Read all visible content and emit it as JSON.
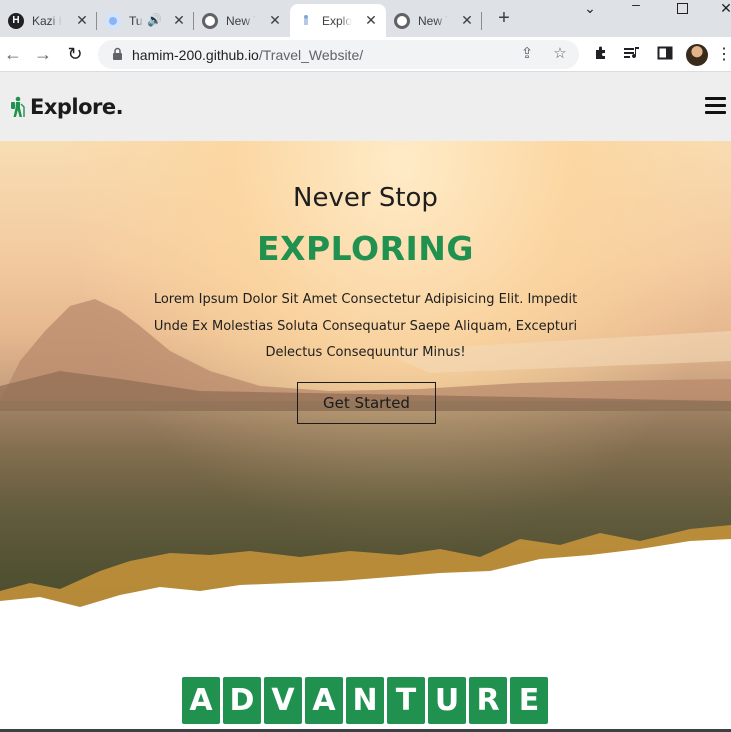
{
  "browser": {
    "tabs": [
      {
        "title": "Kazi H",
        "favicon": "H",
        "favicon_color": "#202124",
        "audio": false,
        "active": false
      },
      {
        "title": "Tu",
        "favicon": "",
        "favicon_color": "#8ab4f8",
        "audio": true,
        "active": false
      },
      {
        "title": "New T",
        "favicon": "chrome",
        "favicon_color": "#5f6368",
        "audio": false,
        "active": false
      },
      {
        "title": "Explor",
        "favicon": "walker",
        "favicon_color": "#219150",
        "audio": false,
        "active": true
      },
      {
        "title": "New T",
        "favicon": "chrome",
        "favicon_color": "#5f6368",
        "audio": false,
        "active": false
      }
    ],
    "url_host": "hamim-200.github.io",
    "url_path": "/Travel_Website/"
  },
  "site": {
    "brand": "Explore.",
    "hero": {
      "subtitle": "Never Stop",
      "title": "EXPLORING",
      "paragraph": "Lorem Ipsum Dolor Sit Amet Consectetur Adipisicing Elit. Impedit Unde Ex Molestias Soluta Consequatur Saepe Aliquam, Excepturi Delectus Consequuntur Minus!",
      "button": "Get Started"
    },
    "section_heading_letters": [
      "A",
      "D",
      "V",
      "A",
      "N",
      "T",
      "U",
      "R",
      "E"
    ]
  },
  "colors": {
    "accent": "#219150",
    "header_bg": "#eeeeee",
    "tabbar_bg": "#dee1e6"
  }
}
